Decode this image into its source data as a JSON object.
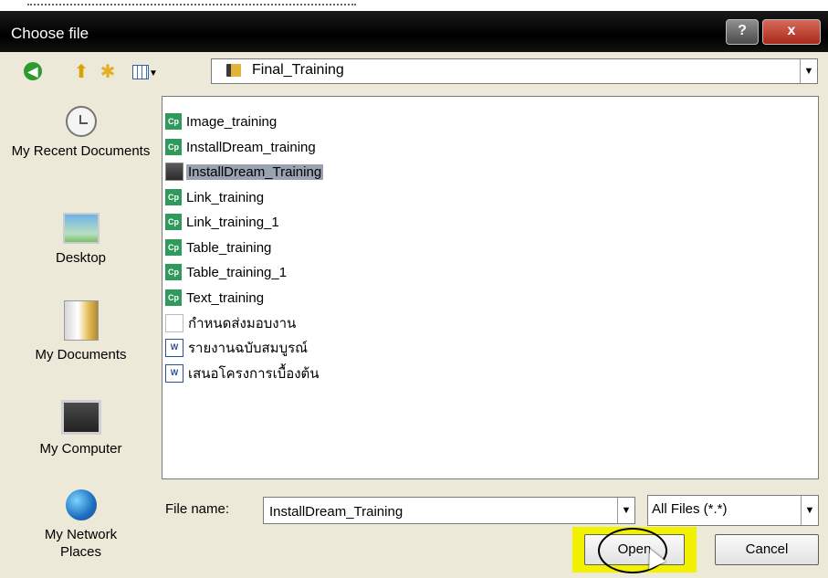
{
  "window": {
    "title": "Choose file",
    "help_label": "?",
    "close_label": "x"
  },
  "toolbar": {
    "back_icon": "back-arrow-icon",
    "up_icon": "up-folder-icon",
    "new_folder_icon": "new-folder-icon",
    "views_icon": "views-menu-icon",
    "look_in": "Final_Training"
  },
  "places": [
    {
      "label": "My Recent Documents",
      "icon": "recent-documents-icon"
    },
    {
      "label": "Desktop",
      "icon": "desktop-icon"
    },
    {
      "label": "My Documents",
      "icon": "my-documents-icon"
    },
    {
      "label": "My Computer",
      "icon": "my-computer-icon"
    },
    {
      "label": "My Network Places",
      "icon": "network-places-icon"
    }
  ],
  "files": [
    {
      "name": "Image_training",
      "type": "cp"
    },
    {
      "name": "InstallDream_training",
      "type": "cp"
    },
    {
      "name": "InstallDream_Training",
      "type": "cp-folder",
      "selected": true
    },
    {
      "name": "Link_training",
      "type": "cp"
    },
    {
      "name": "Link_training_1",
      "type": "cp"
    },
    {
      "name": "Table_training",
      "type": "cp"
    },
    {
      "name": "Table_training_1",
      "type": "cp"
    },
    {
      "name": "Text_training",
      "type": "cp"
    },
    {
      "name": "กำหนดส่งมอบงาน",
      "type": "blank"
    },
    {
      "name": "รายงานฉบับสมบูรณ์",
      "type": "word"
    },
    {
      "name": "เสนอโครงการเบื้องต้น",
      "type": "word"
    }
  ],
  "file_name": {
    "label": "File name:",
    "value": "InstallDream_Training"
  },
  "file_type": {
    "value": "All Files (*.*)"
  },
  "buttons": {
    "open": "Open",
    "cancel": "Cancel"
  },
  "colors": {
    "highlight": "#f2f200",
    "selection": "#9aa3b1",
    "title_bar": "#000000"
  }
}
